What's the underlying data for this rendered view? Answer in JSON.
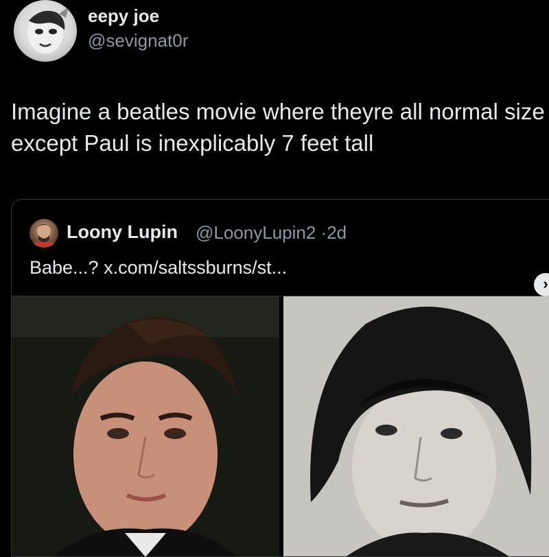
{
  "tweet": {
    "display_name": "eepy joe",
    "handle": "@sevignat0r",
    "text": "Imagine a beatles movie where theyre all normal size except Paul is inexplicably 7 feet tall",
    "avatar_icon": "profile-avatar"
  },
  "quote": {
    "display_name": "Loony Lupin",
    "handle": "@LoonyLupin2",
    "separator": "·",
    "time": "2d",
    "text": "Babe...? x.com/saltssburns/st...",
    "avatar_icon": "profile-avatar",
    "next_icon": "chevron-right-icon"
  },
  "colors": {
    "background": "#000000",
    "text": "#e7e9ea",
    "muted": "#8b98a5",
    "border": "#2f3336"
  }
}
